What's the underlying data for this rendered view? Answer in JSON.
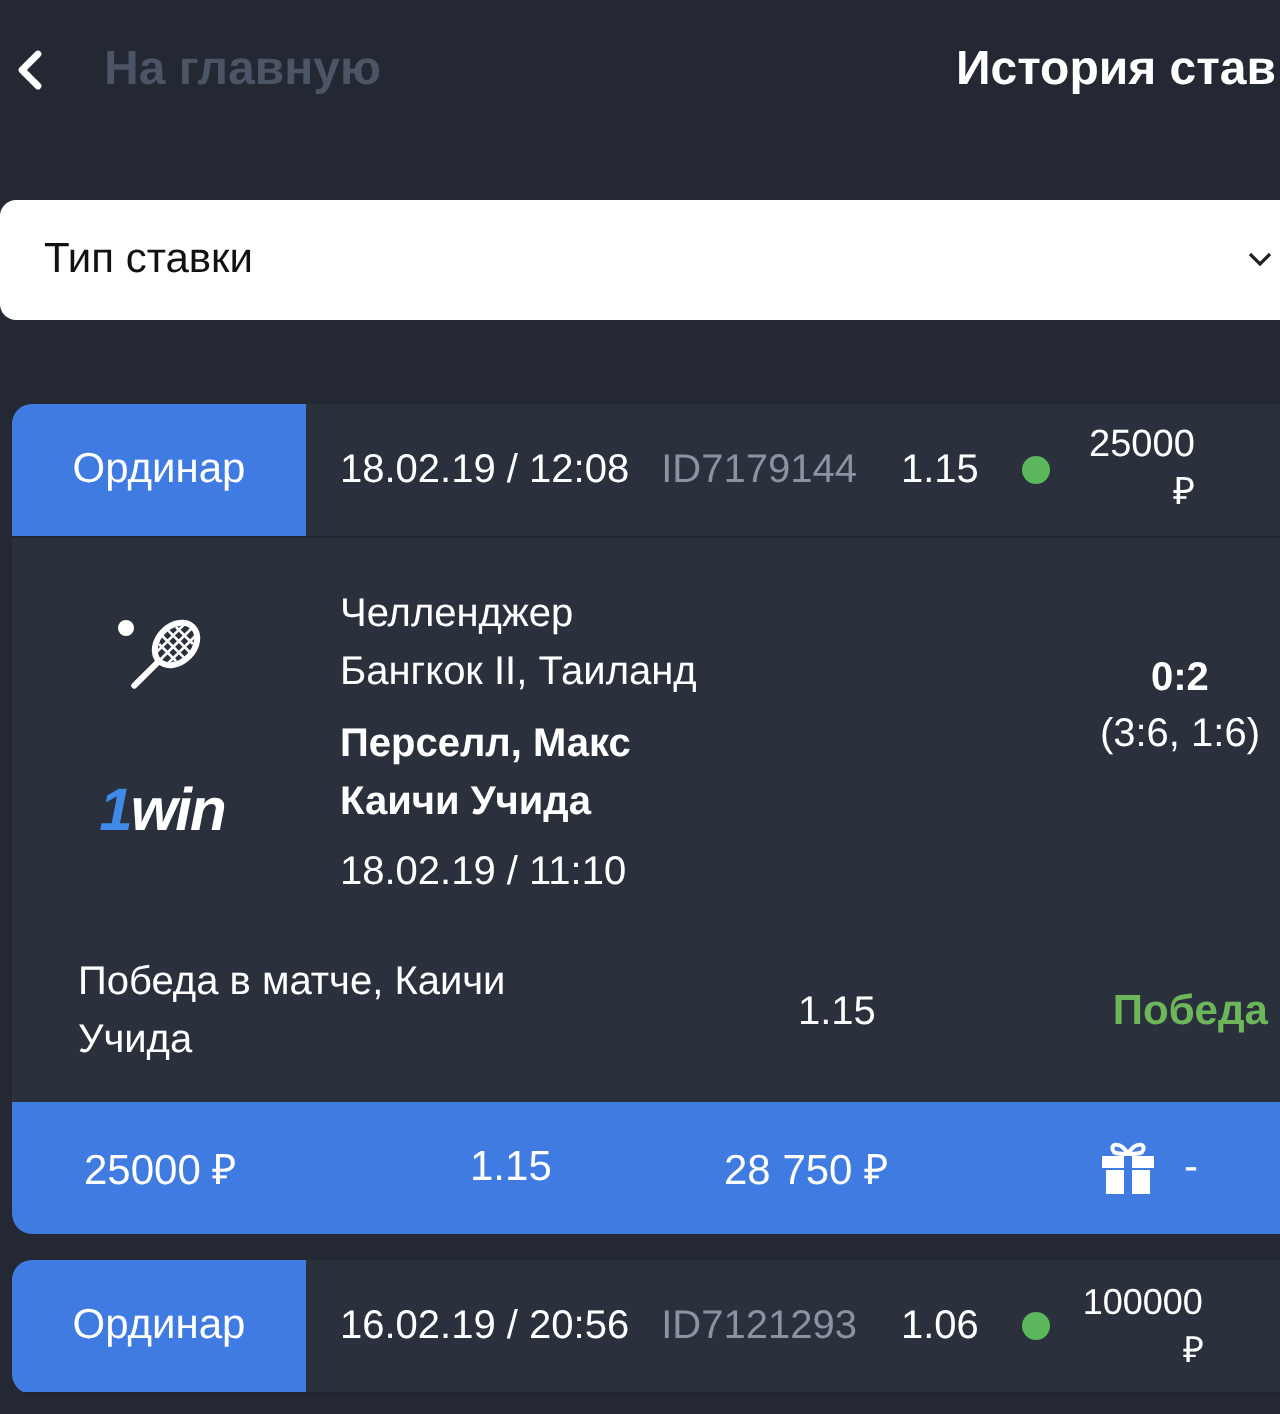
{
  "header": {
    "back_label": "На главную",
    "title": "История став"
  },
  "filter": {
    "value": "Тип ставки"
  },
  "bets": [
    {
      "type": "Ординар",
      "datetime": "18.02.19 / 12:08",
      "id": "ID7179144",
      "odds": "1.15",
      "color": "#5cb85c",
      "amount": "25000 ₽",
      "expanded": true,
      "details": {
        "kind": "tennis",
        "logo": {
          "mark": "1",
          "name": "win"
        },
        "league": "Челленджер",
        "region": "Бангкок II, Таиланд",
        "players": [
          "Перселл, Макс",
          "Каичи Учида"
        ],
        "match_time": "18.02.19 / 11:10",
        "score": "0:2",
        "sets": "(3:6, 1:6)",
        "outcome": "Победа в матче, Каичи Учида",
        "outcome_odds": "1.15",
        "result": {
          "kind": "win",
          "label": "Победа"
        },
        "summary": {
          "stake": "25000 ₽",
          "odds": "1.15",
          "payout": "28 750 ₽",
          "bonus": "-"
        }
      }
    },
    {
      "type": "Ординар",
      "datetime": "16.02.19 / 20:56",
      "id": "ID7121293",
      "odds": "1.06",
      "color": "#5cb85c",
      "amount": "100000 ₽",
      "expanded": false
    }
  ]
}
